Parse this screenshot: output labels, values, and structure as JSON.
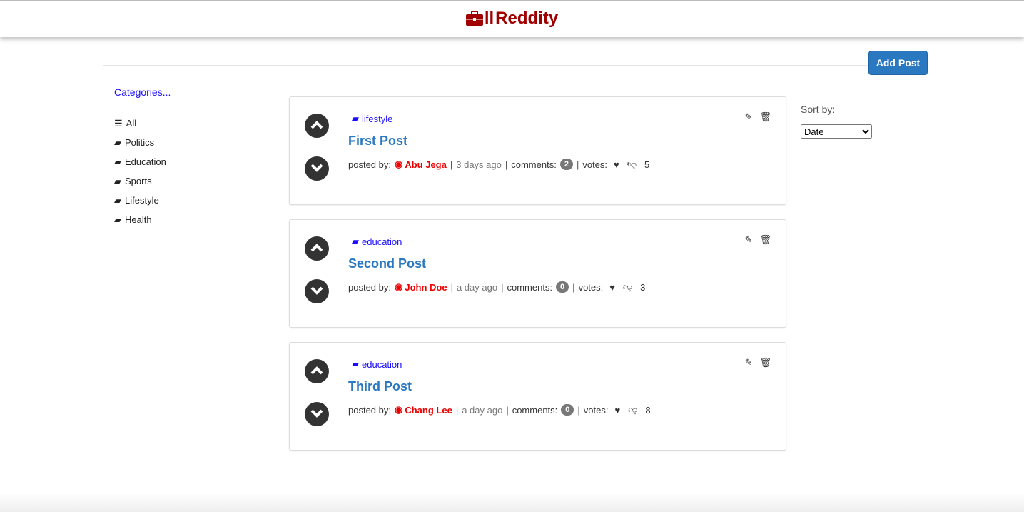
{
  "header": {
    "brand": "Reddity"
  },
  "toolbar": {
    "add_post": "Add Post"
  },
  "categories": {
    "title": "Categories...",
    "items": [
      "All",
      "Politics",
      "Education",
      "Sports",
      "Lifestyle",
      "Health"
    ]
  },
  "sort": {
    "label": "Sort by:",
    "selected": "Date"
  },
  "labels": {
    "posted_by": "posted by:",
    "comments": "comments:",
    "votes": "votes:",
    "sep": "|"
  },
  "posts": [
    {
      "category": "lifestyle",
      "title": "First Post",
      "author": "Abu Jega",
      "time": "3 days ago",
      "comments": "2",
      "votes": "5"
    },
    {
      "category": "education",
      "title": "Second Post",
      "author": "John Doe",
      "time": "a day ago",
      "comments": "0",
      "votes": "3"
    },
    {
      "category": "education",
      "title": "Third Post",
      "author": "Chang Lee",
      "time": "a day ago",
      "comments": "0",
      "votes": "8"
    }
  ]
}
